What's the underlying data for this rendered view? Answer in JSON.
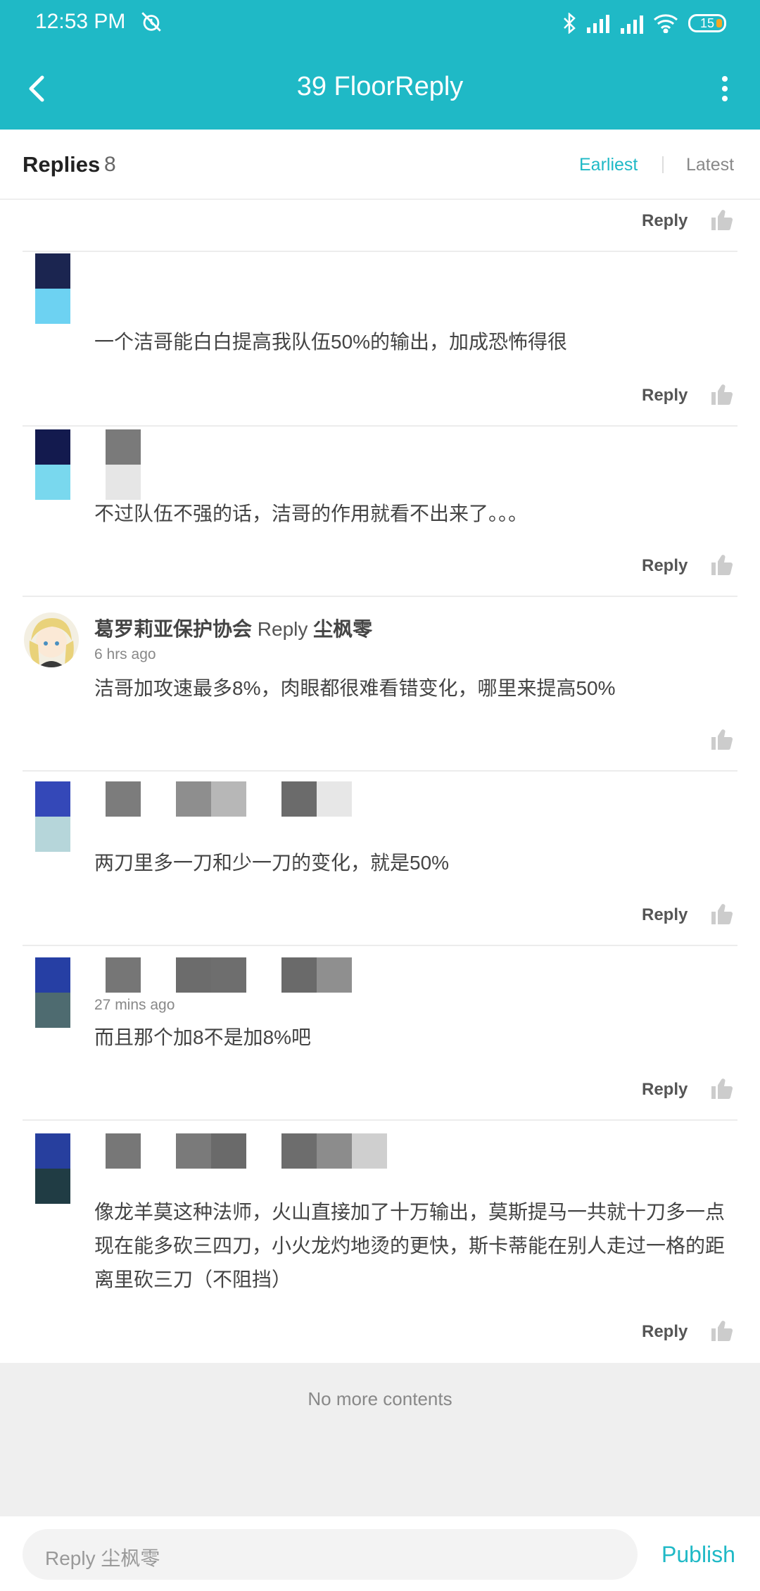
{
  "status_bar": {
    "time": "12:53 PM",
    "battery": "15"
  },
  "header": {
    "title": "39 FloorReply"
  },
  "sort_bar": {
    "label": "Replies",
    "count": "8",
    "earliest": "Earliest",
    "latest": "Latest"
  },
  "reply_label": "Reply",
  "comments": [
    {
      "time": "",
      "text": ""
    },
    {
      "time": "",
      "text": "一个洁哥能白白提高我队伍50%的输出，加成恐怖得很"
    },
    {
      "time": "",
      "text": "不过队伍不强的话，洁哥的作用就看不出来了。。。"
    },
    {
      "name": "葛罗莉亚保护协会",
      "reply_word": "Reply",
      "reply_to": "尘枫零",
      "time": "6 hrs ago",
      "text": "洁哥加攻速最多8%，肉眼都很难看错变化，哪里来提高50%"
    },
    {
      "time": "",
      "text": "两刀里多一刀和少一刀的变化，就是50%"
    },
    {
      "time": "27 mins ago",
      "text": "而且那个加8不是加8%吧"
    },
    {
      "time": "",
      "text": "像龙羊莫这种法师，火山直接加了十万输出，莫斯提马一共就十刀多一点现在能多砍三四刀，小火龙灼地烫的更快，斯卡蒂能在别人走过一格的距离里砍三刀（不阻挡）"
    }
  ],
  "footer": {
    "no_more": "No more contents"
  },
  "input": {
    "placeholder": "Reply 尘枫零",
    "publish": "Publish"
  },
  "colors": {
    "accent": "#1fb9c6"
  }
}
